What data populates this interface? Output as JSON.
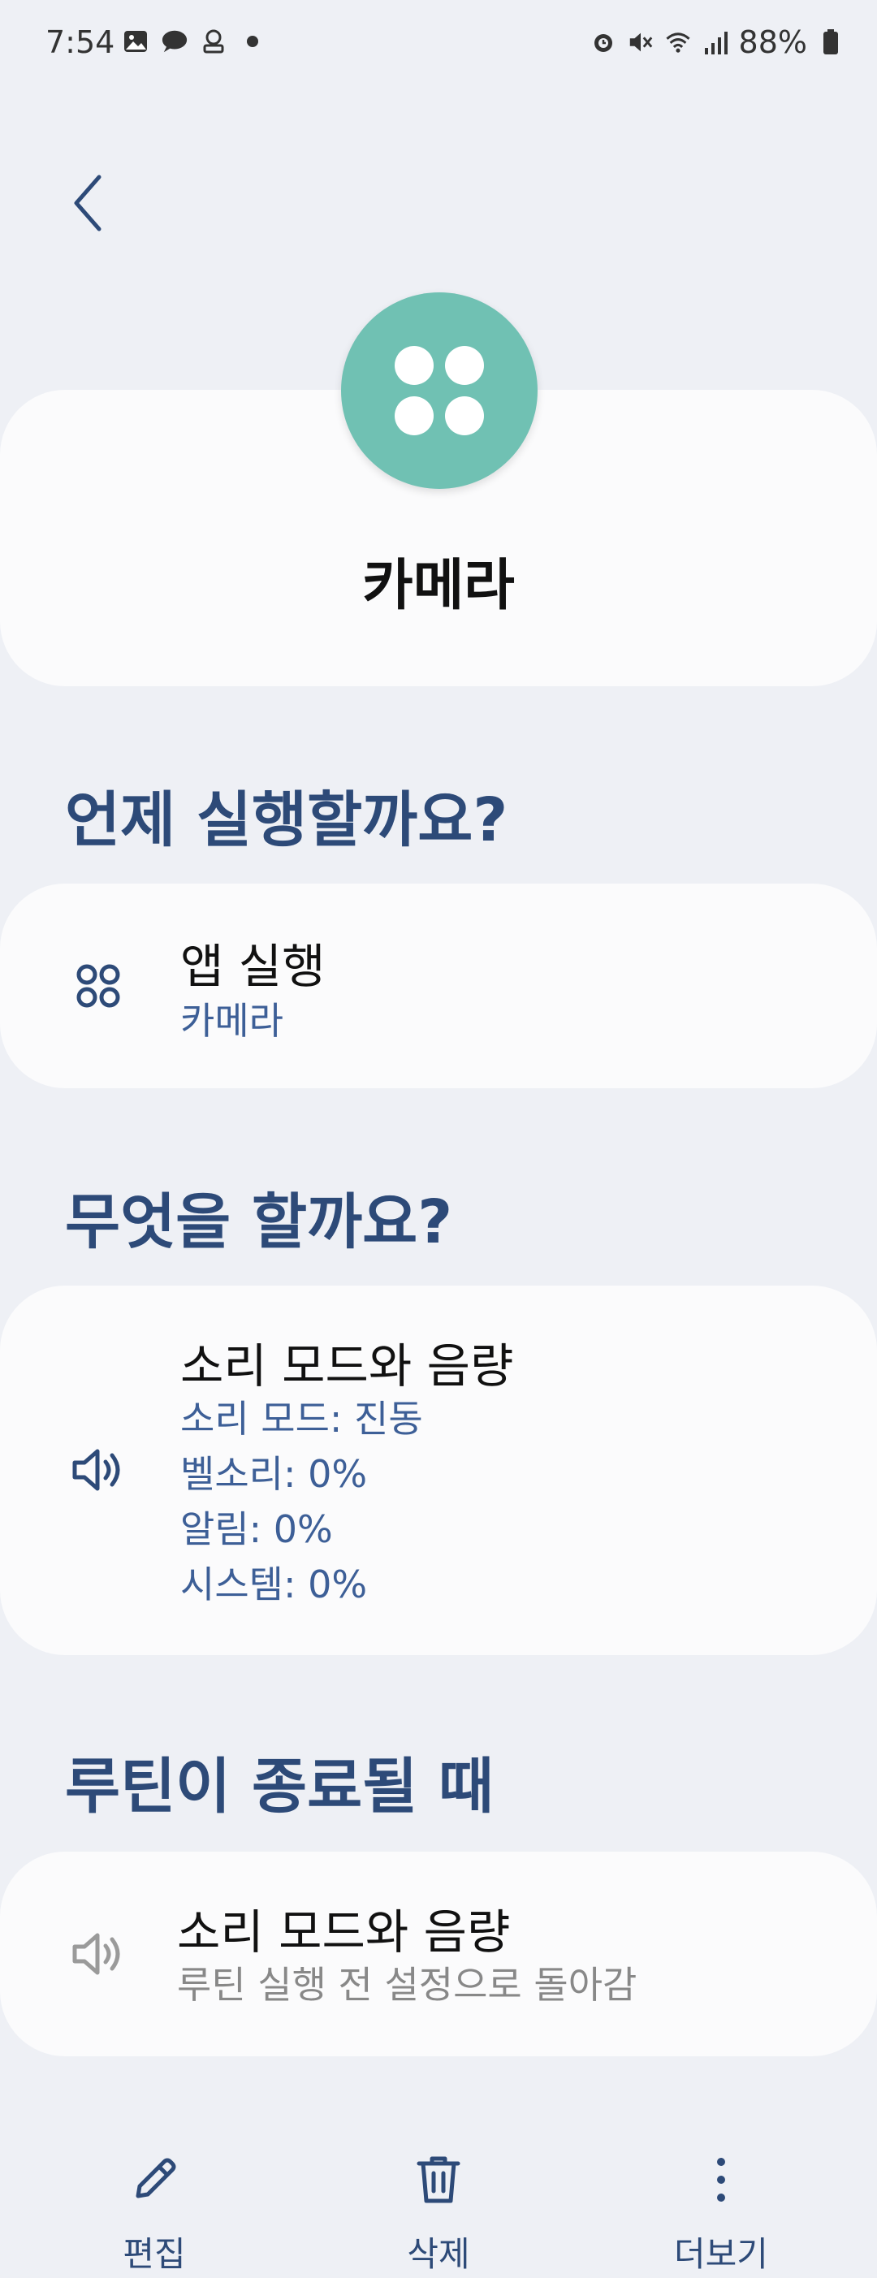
{
  "status_bar": {
    "time": "7:54",
    "battery": "88%",
    "left_icons": [
      "image-icon",
      "chat-bubble-icon",
      "emoji-icon",
      "dot-icon"
    ],
    "right_icons": [
      "alarm-icon",
      "mute-icon",
      "wifi-icon",
      "signal-icon",
      "battery-icon"
    ]
  },
  "header": {
    "title": "카메라",
    "icon": "apps-grid-icon",
    "icon_color": "#70c1b3"
  },
  "trigger_section": {
    "heading": "언제 실행할까요?",
    "card": {
      "icon": "apps-icon",
      "title": "앱 실행",
      "detail": "카메라"
    }
  },
  "action_section": {
    "heading": "무엇을 할까요?",
    "card": {
      "icon": "volume-icon",
      "title": "소리 모드와 음량",
      "details": [
        "소리 모드: 진동",
        "벨소리: 0%",
        "알림: 0%",
        "시스템: 0%"
      ]
    }
  },
  "end_section": {
    "heading": "루틴이 종료될 때",
    "card": {
      "icon": "volume-icon",
      "title": "소리 모드와 음량",
      "detail": "루틴 실행 전 설정으로 돌아감"
    }
  },
  "bottom_nav": {
    "edit": "편집",
    "delete": "삭제",
    "more": "더보기"
  },
  "colors": {
    "accent": "#2d4a78",
    "detail": "#3d5f97",
    "background": "#eef0f5",
    "card": "#fbfbfc"
  }
}
